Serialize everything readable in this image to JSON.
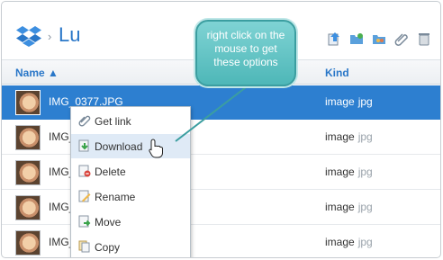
{
  "header": {
    "breadcrumb_title": "Lu",
    "breadcrumb_separator": "›",
    "toolbar_icons": [
      "upload-icon",
      "new-folder-icon",
      "shared-folder-icon",
      "link-icon",
      "trash-icon"
    ]
  },
  "columns": {
    "name": "Name ▲",
    "kind": "Kind"
  },
  "rows": [
    {
      "name": "IMG_0377.JPG",
      "kind": "image",
      "ext": "jpg",
      "selected": true
    },
    {
      "name": "IMG_",
      "kind": "image",
      "ext": "jpg"
    },
    {
      "name": "IMG_",
      "kind": "image",
      "ext": "jpg"
    },
    {
      "name": "IMG_",
      "kind": "image",
      "ext": "jpg"
    },
    {
      "name": "IMG_",
      "kind": "image",
      "ext": "jpg"
    }
  ],
  "context_menu": {
    "items": [
      {
        "label": "Get link",
        "icon": "paperclip-icon"
      },
      {
        "label": "Download",
        "icon": "download-icon",
        "hover": true
      },
      {
        "label": "Delete",
        "icon": "delete-icon"
      },
      {
        "label": "Rename",
        "icon": "rename-icon"
      },
      {
        "label": "Move",
        "icon": "move-icon"
      },
      {
        "label": "Copy",
        "icon": "copy-icon"
      }
    ]
  },
  "callout": {
    "text": "right click on the mouse to get these options"
  },
  "colors": {
    "accent": "#2d7fd0",
    "callout": "#4eb7b8",
    "link": "#2a77c8"
  }
}
